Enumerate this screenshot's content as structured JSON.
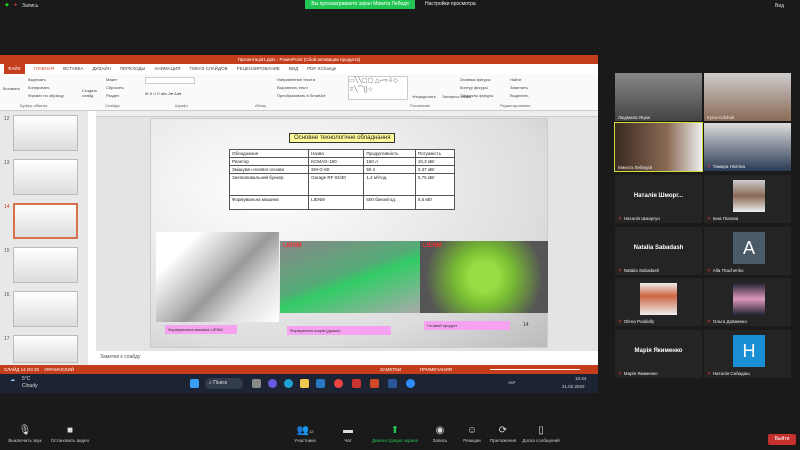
{
  "zoom": {
    "top_left": "Запись",
    "banner": "Вы просматриваете экран Микита Лебедя",
    "view_options": "Настройки просмотра",
    "view": "Вид",
    "toolbar": [
      {
        "label": "Выключить звук",
        "icon": "microphone-icon"
      },
      {
        "label": "Остановить видео",
        "icon": "video-icon"
      },
      {
        "label": "Участники",
        "icon": "participants-icon",
        "count": "12"
      },
      {
        "label": "Чат",
        "icon": "chat-icon"
      },
      {
        "label": "Демонстрация экрана",
        "icon": "share-screen-icon"
      },
      {
        "label": "Запись",
        "icon": "record-icon"
      },
      {
        "label": "Реакции",
        "icon": "reactions-icon"
      },
      {
        "label": "Приложения",
        "icon": "apps-icon"
      },
      {
        "label": "Доска сообщений",
        "icon": "whiteboard-icon"
      }
    ],
    "leave": "Выйти",
    "participants": [
      {
        "name": "Людмила Яцюк",
        "type": "video"
      },
      {
        "name": "Iryna Kolchuk",
        "type": "video"
      },
      {
        "name": "Микита Лебедєв",
        "type": "video",
        "active": true
      },
      {
        "name": "Тамара Нікітіна",
        "type": "video"
      },
      {
        "name": "Наталія Шморгун",
        "display": "Наталія Шморг...",
        "type": "name"
      },
      {
        "name": "Інна Попова",
        "type": "photo"
      },
      {
        "name": "Natalia Sabadash",
        "display": "Natalia Sabadash",
        "type": "name"
      },
      {
        "name": "Alla Tkachenko",
        "type": "letter",
        "letter": "A",
        "color": "#4a5a66"
      },
      {
        "name": "Olena Poddolly",
        "type": "photo"
      },
      {
        "name": "Ольга Довженко",
        "type": "photo"
      },
      {
        "name": "Марія Якименко",
        "display": "Марія Якименко",
        "type": "name"
      },
      {
        "name": "Наталія Сабадаш",
        "type": "letter",
        "letter": "H",
        "color": "#1a8fd6"
      }
    ]
  },
  "ppt": {
    "title": "Презентація1.pptx - PowerPoint (Сбой активации продукта)",
    "tabs": [
      "ФАЙЛ",
      "ГЛАВНАЯ",
      "ВСТАВКА",
      "ДИЗАЙН",
      "ПЕРЕХОДЫ",
      "АНИМАЦИЯ",
      "ПОКАЗ СЛАЙДОВ",
      "РЕЦЕНЗИРОВАНИЕ",
      "ВИД",
      "PDF-XChange"
    ],
    "ribbon": {
      "paste": "Вставить",
      "cut": "Вырезать",
      "copy": "Копировать",
      "format": "Формат по образцу",
      "new_slide": "Создать слайд",
      "layout": "Макет",
      "reset": "Сбросить",
      "section": "Раздел",
      "text_dir": "Направление текста",
      "align": "Выровнять текст",
      "smartart": "Преобразовать в SmartArt",
      "arrange": "Упорядочить",
      "quick_styles": "Экспресс-стили",
      "fill": "Заливка фигуры",
      "outline": "Контур фигуры",
      "effects": "Эффекты фигуры",
      "find": "Найти",
      "replace": "Заменить",
      "select": "Выделить",
      "groups": [
        "Буфер обмена",
        "Слайды",
        "Шрифт",
        "Абзац",
        "Рисование",
        "Редактирование"
      ]
    },
    "thumb_numbers": [
      "12",
      "13",
      "14",
      "15",
      "16",
      "17"
    ],
    "current_slide": "14",
    "slide": {
      "title": "Основне технологічне обладнання",
      "headers": [
        "Обладнання",
        "Назва",
        "Продуктивність",
        "Потужність"
      ],
      "rows": [
        [
          "Реактор",
          "KCMAG-150",
          "150 л",
          "10,3 кВт"
        ],
        [
          "Змішувач гелевої основи",
          "SM-G-60",
          "50 л",
          "0,37 кВт"
        ],
        [
          "Знепилювальний бункер",
          "Garage RF 02/30",
          "1,4 м³/год.",
          "0,75 кВт"
        ],
        [
          "Формувальна машина",
          "LIENM",
          "600 банок/год.",
          "6,5 кВт"
        ]
      ],
      "captions": [
        "Формувальна машина LIENM",
        "Формування шарів (драже)",
        "Готовий продукт"
      ],
      "logo": "LIENM",
      "number": "14"
    },
    "notes": "Заметки к слайду",
    "status": {
      "slide": "СЛАЙД 14 ИЗ 30",
      "lang": "УКРАИНСКИЙ",
      "notes": "ЗАМЕТКИ",
      "comments": "ПРИМЕЧАНИЯ"
    }
  },
  "taskbar": {
    "weather": "5°C",
    "weather_desc": "Cloudy",
    "search": "Поиск",
    "lang": "УКР",
    "time": "10:44",
    "date": "21.02.2023"
  }
}
